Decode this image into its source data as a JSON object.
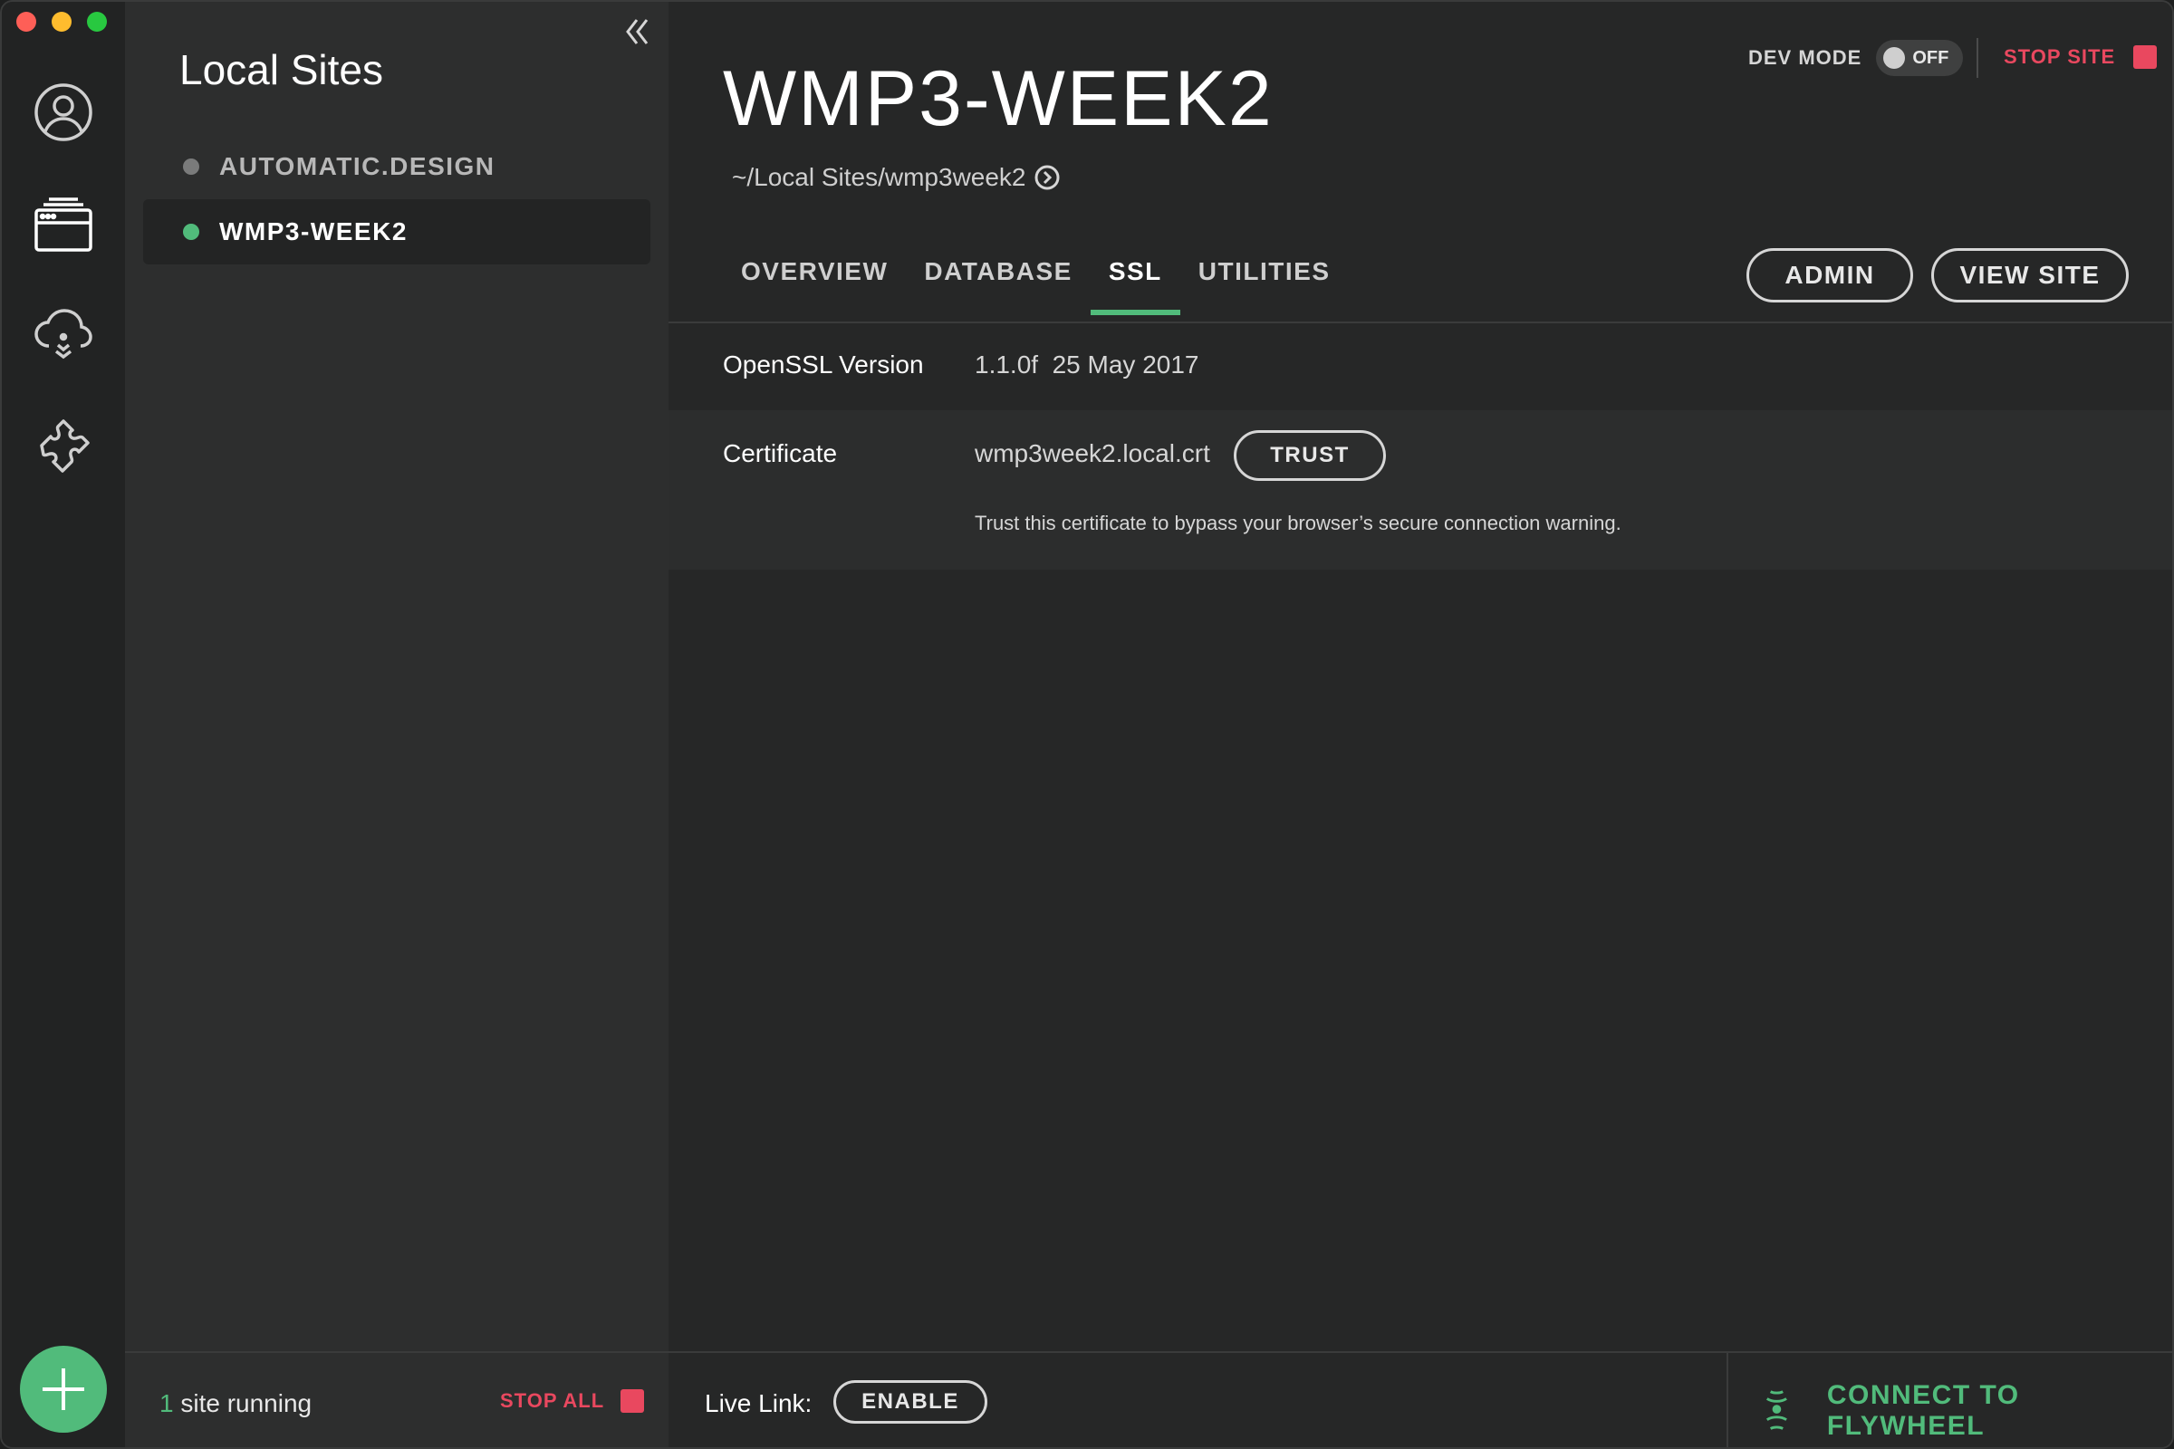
{
  "colors": {
    "accent": "#51bb7b",
    "danger": "#e9485f",
    "background": "#262727",
    "sidebar": "#2d2e2e",
    "rail": "#222323"
  },
  "rail": {
    "icons": [
      "user-circle-icon",
      "sites-browser-icon",
      "cloud-sync-icon",
      "addons-puzzle-icon"
    ],
    "add_icon": "plus-icon"
  },
  "sidebar": {
    "title": "Local Sites",
    "collapse_icon": "double-chevron-left-icon",
    "sites": [
      {
        "name": "AUTOMATIC.DESIGN",
        "status": "stopped",
        "dot_color": "#7a7b7b",
        "text_color": "#b8b8b8"
      },
      {
        "name": "WMP3-WEEK2",
        "status": "running",
        "dot_color": "#51bb7b",
        "text_color": "#ffffff"
      }
    ],
    "footer": {
      "running_count": "1",
      "running_text": " site running",
      "stop_all_label": "STOP ALL"
    }
  },
  "header": {
    "site_name": "WMP3-WEEK2",
    "path": "~/Local Sites/wmp3week2",
    "dev_mode_label": "DEV MODE",
    "dev_mode_state": "OFF",
    "stop_site_label": "STOP SITE"
  },
  "tabs": [
    {
      "label": "OVERVIEW",
      "active": false
    },
    {
      "label": "DATABASE",
      "active": false
    },
    {
      "label": "SSL",
      "active": true
    },
    {
      "label": "UTILITIES",
      "active": false
    }
  ],
  "actions": {
    "admin_label": "ADMIN",
    "view_site_label": "VIEW SITE"
  },
  "ssl": {
    "openssl_label": "OpenSSL Version",
    "openssl_value": "1.1.0f  25 May 2017",
    "certificate_label": "Certificate",
    "certificate_value": "wmp3week2.local.crt",
    "trust_label": "TRUST",
    "trust_hint": "Trust this certificate to bypass your browser’s secure connection warning."
  },
  "footer": {
    "live_link_label": "Live Link:",
    "enable_label": "ENABLE",
    "connect_label": "CONNECT TO FLYWHEEL"
  }
}
